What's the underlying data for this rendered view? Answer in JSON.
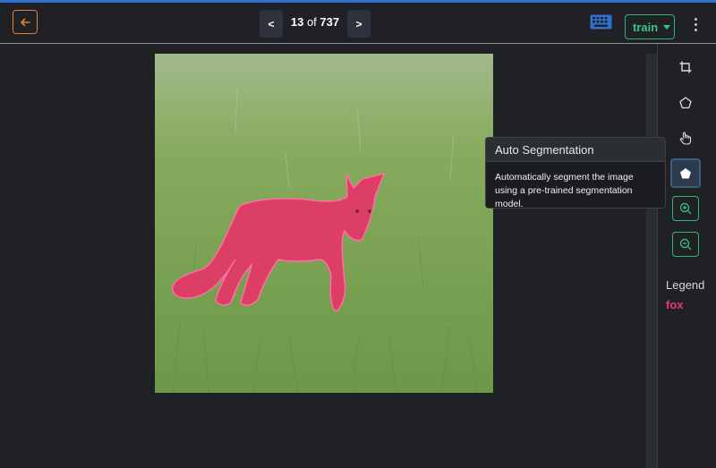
{
  "header": {
    "back_icon": "arrow-left-icon",
    "prev_label": "<",
    "next_label": ">",
    "current_index": "13",
    "of_text": "of",
    "total": "737",
    "keyboard_icon": "keyboard-icon",
    "split_label": "train",
    "more_icon": "more-vertical-icon",
    "accent_colors": {
      "back": "#e0803a",
      "split": "#36c68a",
      "keyboard": "#2f6fd1"
    }
  },
  "toolbar": {
    "tools": [
      {
        "icon": "crop-icon"
      },
      {
        "icon": "polygon-icon"
      },
      {
        "icon": "hand-pointer-icon"
      },
      {
        "icon": "auto-segmentation-icon",
        "active": true
      },
      {
        "icon": "zoom-in-icon"
      },
      {
        "icon": "zoom-out-icon"
      }
    ]
  },
  "tooltip": {
    "title": "Auto Segmentation",
    "body": "Automatically segment the image using a pre-trained segmentation model."
  },
  "legend": {
    "title": "Legend",
    "items": [
      {
        "label": "fox",
        "color": "#e8396e"
      }
    ]
  },
  "annotation": {
    "label": "fox",
    "color": "#e8396e"
  }
}
